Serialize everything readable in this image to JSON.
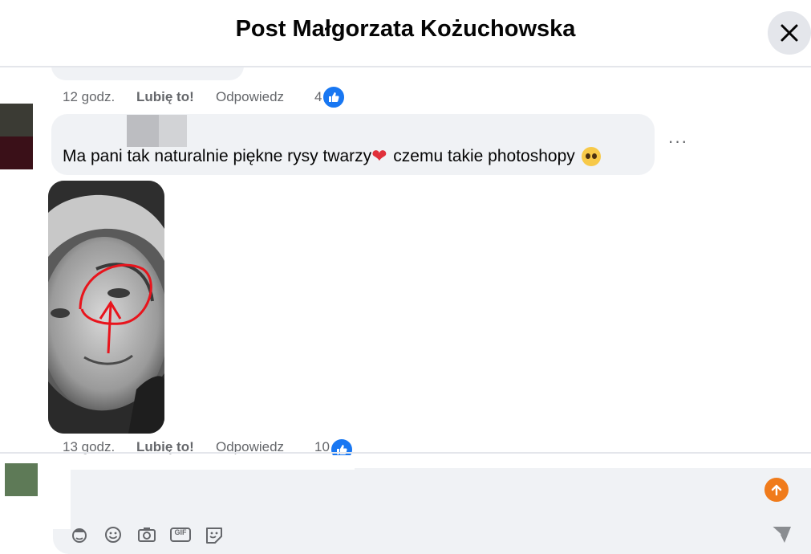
{
  "header": {
    "title": "Post Małgorzata Kożuchowska"
  },
  "previous_comment": {
    "time": "12 godz.",
    "like_label": "Lubię to!",
    "reply_label": "Odpowiedz",
    "like_count": "4"
  },
  "comment": {
    "text_before_emoji": "Ma pani tak naturalnie piękne rysy twarzy",
    "heart_emoji": "❤",
    "text_after_emoji": " czemu takie photoshopy",
    "more_label": "···",
    "time": "13 godz.",
    "like_label": "Lubię to!",
    "reply_label": "Odpowiedz",
    "like_count": "10"
  },
  "composer": {
    "tools": [
      "avatar-sticker-icon",
      "emoji-icon",
      "camera-icon",
      "gif-icon",
      "sticker-icon"
    ],
    "gif_label": "GIF"
  },
  "colors": {
    "accent_blue": "#1877f2",
    "send_orange": "#f07b1b",
    "bubble_gray": "#f0f2f5"
  }
}
